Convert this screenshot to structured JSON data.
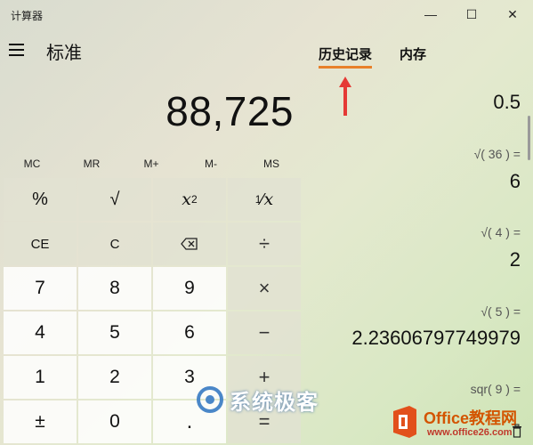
{
  "window": {
    "title": "计算器",
    "min_icon": "minimize-icon",
    "max_icon": "maximize-icon",
    "close_icon": "close-icon",
    "min_glyph": "—",
    "max_glyph": "☐",
    "close_glyph": "✕"
  },
  "header": {
    "mode": "标准",
    "menu_icon": "hamburger-menu-icon"
  },
  "display": {
    "value": "88,725"
  },
  "memory": [
    "MC",
    "MR",
    "M+",
    "M-",
    "MS"
  ],
  "keys": {
    "percent": "%",
    "sqrt": "√",
    "square_base": "x",
    "square_exp": "2",
    "recip_num": "1",
    "recip_den": "x",
    "ce": "CE",
    "c": "C",
    "backspace_icon": "backspace-icon",
    "divide": "÷",
    "n7": "7",
    "n8": "8",
    "n9": "9",
    "multiply": "×",
    "n4": "4",
    "n5": "5",
    "n6": "6",
    "minus": "−",
    "n1": "1",
    "n2": "2",
    "n3": "3",
    "plus": "+",
    "negate": "±",
    "n0": "0",
    "decimal": ".",
    "equals": "="
  },
  "tabs": {
    "history": "历史记录",
    "memory": "内存",
    "active": "history",
    "accent": "#e8802a"
  },
  "history": [
    {
      "expr": "",
      "value": "0.5"
    },
    {
      "expr": "√( 36 ) =",
      "value": "6"
    },
    {
      "expr": "√( 4 ) =",
      "value": "2"
    },
    {
      "expr": "√( 5 ) =",
      "value": "2.23606797749979"
    },
    {
      "expr": "sqr( 9 ) =",
      "value": ""
    }
  ],
  "watermarks": {
    "site1": "系统极客",
    "site2": "Office教程网",
    "site2_sub": "www.office26.com"
  },
  "annotation": {
    "arrow_color": "#e53935"
  }
}
